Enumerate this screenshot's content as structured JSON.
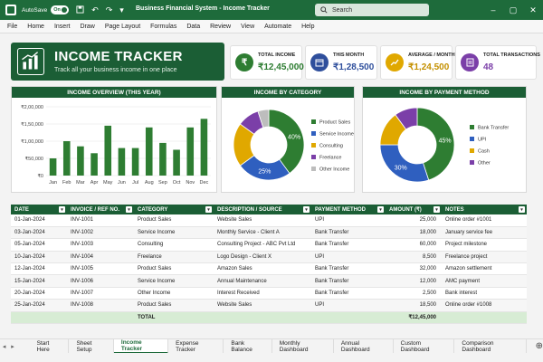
{
  "titlebar": {
    "autosave_label": "AutoSave",
    "autosave_state": "On",
    "doc_title": "Business Financial System - Income Tracker",
    "search_placeholder": "Search"
  },
  "menu": [
    "File",
    "Home",
    "Insert",
    "Draw",
    "Page Layout",
    "Formulas",
    "Data",
    "Review",
    "View",
    "Automate",
    "Help"
  ],
  "header": {
    "title": "INCOME TRACKER",
    "subtitle": "Track all your business income in one place"
  },
  "kpis": [
    {
      "label": "TOTAL INCOME",
      "value": "₹12,45,000",
      "color": "#2e7d32",
      "icon": "rupee-icon"
    },
    {
      "label": "THIS MONTH",
      "value": "₹1,28,500",
      "color": "#2f4f9c",
      "icon": "calendar-icon"
    },
    {
      "label": "AVERAGE / MONTH",
      "value": "₹1,24,500",
      "color": "#e0a800",
      "icon": "chart-growth-icon"
    },
    {
      "label": "TOTAL TRANSACTIONS",
      "value": "48",
      "color": "#7b3fa8",
      "icon": "document-icon"
    }
  ],
  "colors": {
    "green": "#2e7d32",
    "blue": "#2f5fbf",
    "gold": "#e0a800",
    "purple": "#7b3fa8",
    "gray": "#bdbdbd",
    "dark_green": "#1b5e35",
    "total_row": "#d7ecd4"
  },
  "overview": {
    "title": "INCOME OVERVIEW (THIS YEAR)",
    "chart_data": {
      "type": "bar",
      "categories": [
        "Jan",
        "Feb",
        "Mar",
        "Apr",
        "May",
        "Jun",
        "Jul",
        "Aug",
        "Sep",
        "Oct",
        "Nov",
        "Dec"
      ],
      "values": [
        50000,
        100000,
        85000,
        65000,
        145000,
        80000,
        80000,
        140000,
        95000,
        75000,
        140000,
        165000
      ],
      "yticks": [
        "₹0",
        "₹50,000",
        "₹1,00,000",
        "₹1,50,000",
        "₹2,00,000"
      ],
      "ylim": [
        0,
        200000
      ],
      "color": "#2e7d32"
    }
  },
  "by_category": {
    "title": "INCOME BY CATEGORY",
    "chart_data": {
      "type": "pie",
      "labels": [
        "Product Sales",
        "Service Income",
        "Consulting",
        "Freelance",
        "Other Income"
      ],
      "values": [
        40,
        25,
        20,
        10,
        5
      ],
      "slice_labels": [
        "40%",
        "25%",
        "",
        "",
        ""
      ],
      "colors": [
        "#2e7d32",
        "#2f5fbf",
        "#e0a800",
        "#7b3fa8",
        "#bdbdbd"
      ]
    }
  },
  "by_payment": {
    "title": "INCOME BY PAYMENT METHOD",
    "chart_data": {
      "type": "pie",
      "labels": [
        "Bank Transfer",
        "UPI",
        "Cash",
        "Other"
      ],
      "values": [
        45,
        30,
        15,
        10
      ],
      "slice_labels": [
        "45%",
        "30%",
        "",
        ""
      ],
      "colors": [
        "#2e7d32",
        "#2f5fbf",
        "#e0a800",
        "#7b3fa8"
      ]
    }
  },
  "table": {
    "columns": [
      "DATE",
      "INVOICE / REF NO.",
      "CATEGORY",
      "DESCRIPTION / SOURCE",
      "PAYMENT METHOD",
      "AMOUNT (₹)",
      "NOTES"
    ],
    "rows": [
      [
        "01-Jan-2024",
        "INV-1001",
        "Product Sales",
        "Website Sales",
        "UPI",
        "25,000",
        "Online order #1001"
      ],
      [
        "03-Jan-2024",
        "INV-1002",
        "Service Income",
        "Monthly Service - Client A",
        "Bank Transfer",
        "18,000",
        "January service fee"
      ],
      [
        "05-Jan-2024",
        "INV-1003",
        "Consulting",
        "Consulting Project - ABC Pvt Ltd",
        "Bank Transfer",
        "60,000",
        "Project milestone"
      ],
      [
        "10-Jan-2024",
        "INV-1004",
        "Freelance",
        "Logo Design - Client X",
        "UPI",
        "8,500",
        "Freelance project"
      ],
      [
        "12-Jan-2024",
        "INV-1005",
        "Product Sales",
        "Amazon Sales",
        "Bank Transfer",
        "32,000",
        "Amazon settlement"
      ],
      [
        "15-Jan-2024",
        "INV-1006",
        "Service Income",
        "Annual Maintenance",
        "Bank Transfer",
        "12,000",
        "AMC payment"
      ],
      [
        "20-Jan-2024",
        "INV-1007",
        "Other Income",
        "Interest Received",
        "Bank Transfer",
        "2,500",
        "Bank interest"
      ],
      [
        "25-Jan-2024",
        "INV-1008",
        "Product Sales",
        "Website Sales",
        "UPI",
        "18,500",
        "Online order #1008"
      ]
    ],
    "total_label": "TOTAL",
    "total_value": "₹12,45,000"
  },
  "sheet_tabs": [
    "Start Here",
    "Sheet Setup",
    "Income Tracker",
    "Expense Tracker",
    "Bank Balance",
    "Monthly Dashboard",
    "Annual Dashboard",
    "Custom Dashboard",
    "Comparison Dashboard"
  ],
  "active_tab": "Income Tracker"
}
